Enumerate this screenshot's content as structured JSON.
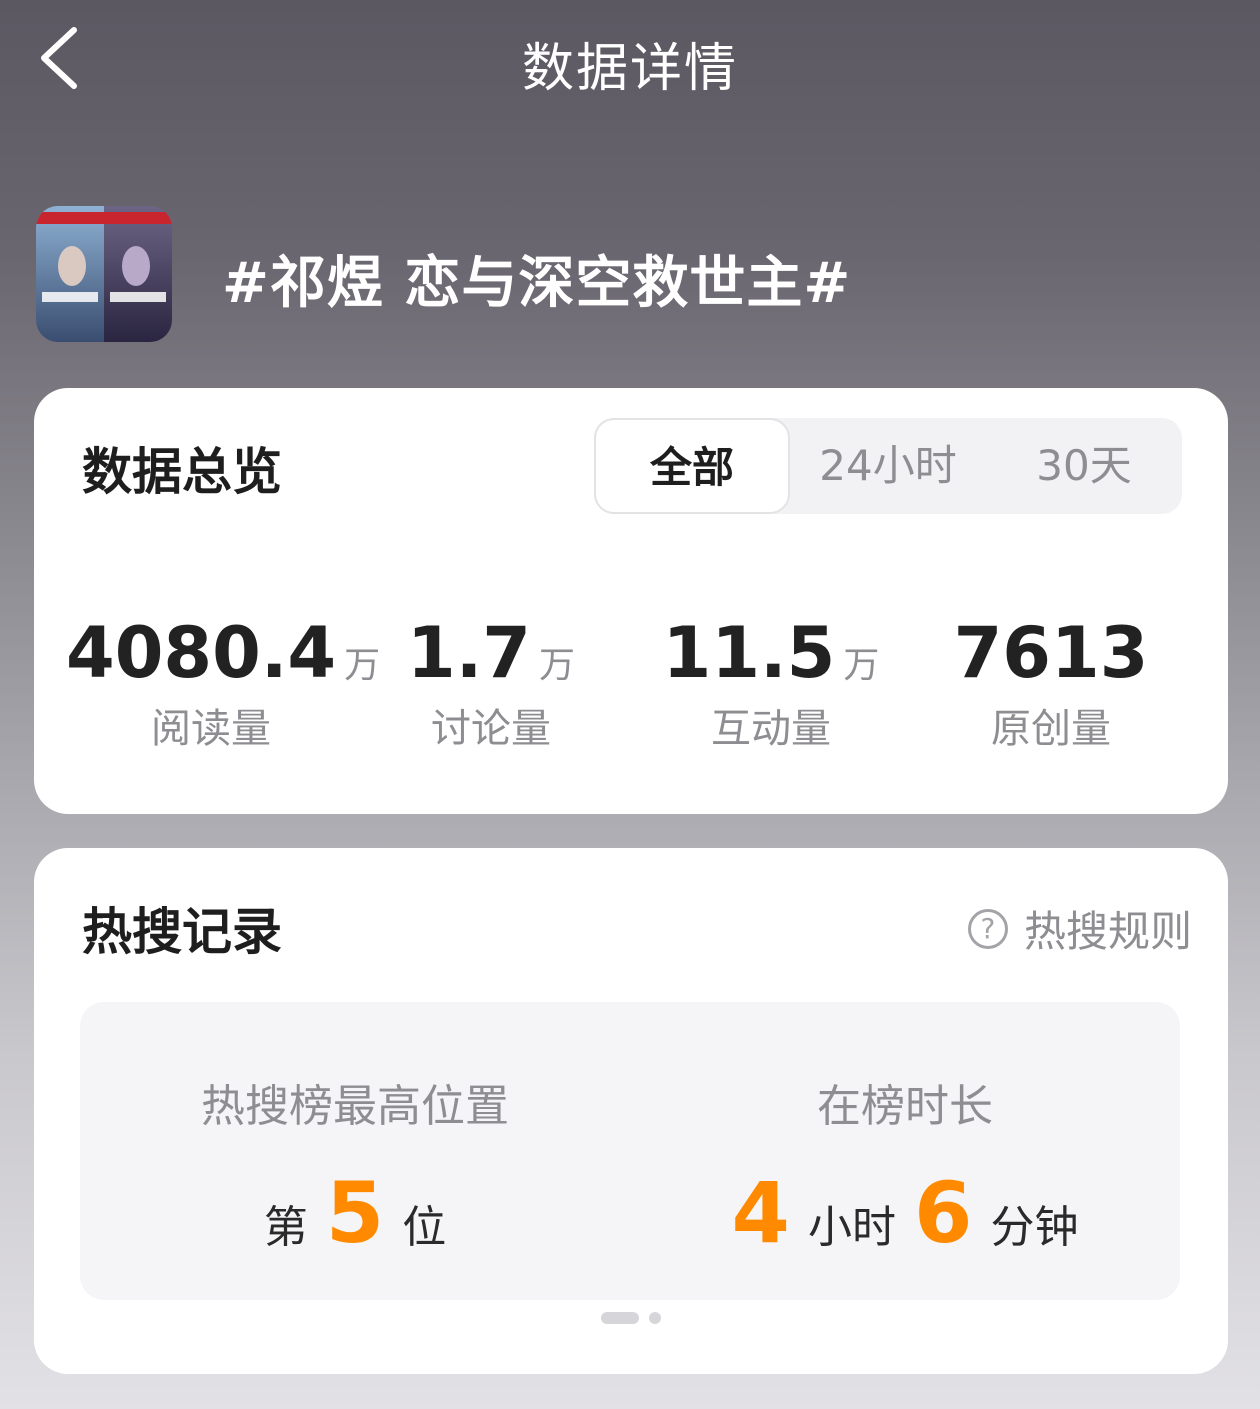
{
  "header": {
    "title": "数据详情"
  },
  "topic": {
    "title": "#祁煜 恋与深空救世主#"
  },
  "overview": {
    "title": "数据总览",
    "tabs": [
      {
        "label": "全部",
        "active": true
      },
      {
        "label": "24小时",
        "active": false
      },
      {
        "label": "30天",
        "active": false
      }
    ],
    "stats": [
      {
        "value": "4080.4",
        "unit": "万",
        "label": "阅读量"
      },
      {
        "value": "1.7",
        "unit": "万",
        "label": "讨论量"
      },
      {
        "value": "11.5",
        "unit": "万",
        "label": "互动量"
      },
      {
        "value": "7613",
        "unit": "",
        "label": "原创量"
      }
    ]
  },
  "hot_search": {
    "title": "热搜记录",
    "rules_label": "热搜规则",
    "best_position": {
      "label": "热搜榜最高位置",
      "prefix": "第",
      "value": "5",
      "suffix": "位"
    },
    "duration": {
      "label": "在榜时长",
      "hours": "4",
      "hours_unit": "小时",
      "minutes": "6",
      "minutes_unit": "分钟"
    }
  },
  "colors": {
    "accent": "#ff8a00"
  },
  "icons": {
    "back": "chevron-left-icon",
    "rules": "question-circle-icon"
  }
}
